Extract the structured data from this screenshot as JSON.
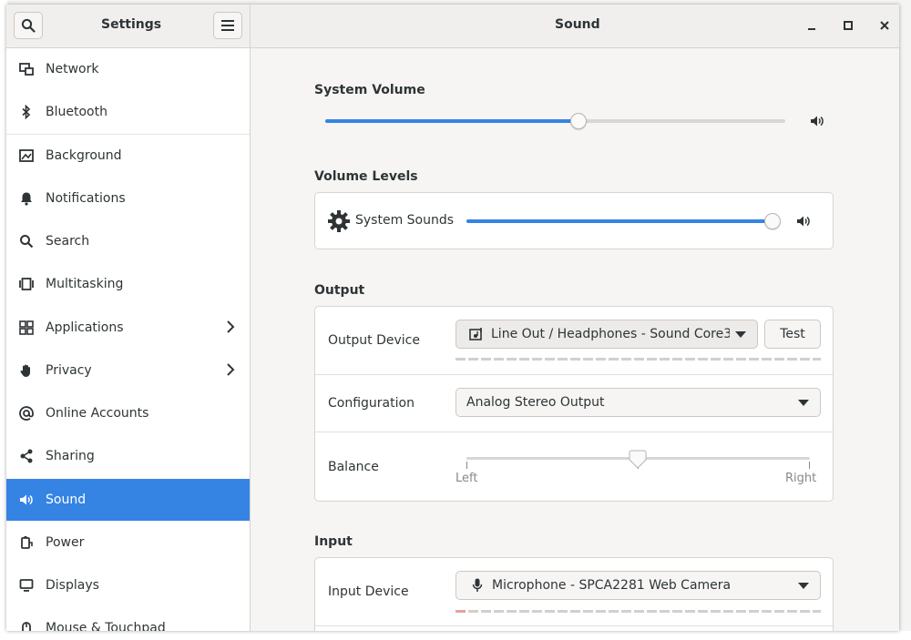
{
  "header": {
    "sidebar_title": "Settings",
    "page_title": "Sound"
  },
  "sidebar": {
    "items": [
      {
        "label": "Network",
        "icon": "network-icon"
      },
      {
        "label": "Bluetooth",
        "icon": "bluetooth-icon"
      },
      {
        "label": "Background",
        "icon": "background-icon"
      },
      {
        "label": "Notifications",
        "icon": "bell-icon"
      },
      {
        "label": "Search",
        "icon": "search-icon"
      },
      {
        "label": "Multitasking",
        "icon": "multitasking-icon"
      },
      {
        "label": "Applications",
        "icon": "grid-icon"
      },
      {
        "label": "Privacy",
        "icon": "hand-icon"
      },
      {
        "label": "Online Accounts",
        "icon": "at-icon"
      },
      {
        "label": "Sharing",
        "icon": "share-icon"
      },
      {
        "label": "Sound",
        "icon": "speaker-icon"
      },
      {
        "label": "Power",
        "icon": "power-icon"
      },
      {
        "label": "Displays",
        "icon": "display-icon"
      },
      {
        "label": "Mouse & Touchpad",
        "icon": "mouse-icon"
      }
    ],
    "active": "Sound"
  },
  "system_volume": {
    "title": "System Volume",
    "level": 0.55
  },
  "volume_levels": {
    "title": "Volume Levels",
    "system_sounds_label": "System Sounds",
    "system_sounds_level": 1.0
  },
  "output": {
    "title": "Output",
    "device_label": "Output Device",
    "device_value": "Line Out / Headphones - Sound Core3…",
    "test_label": "Test",
    "config_label": "Configuration",
    "config_value": "Analog Stereo Output",
    "balance_label": "Balance",
    "balance_level": 0.5,
    "left_label": "Left",
    "right_label": "Right"
  },
  "input": {
    "title": "Input",
    "device_label": "Input Device",
    "device_value": "Microphone - SPCA2281 Web Camera"
  },
  "colors": {
    "accent": "#3584e4",
    "input_level": "#e8a0a0"
  }
}
